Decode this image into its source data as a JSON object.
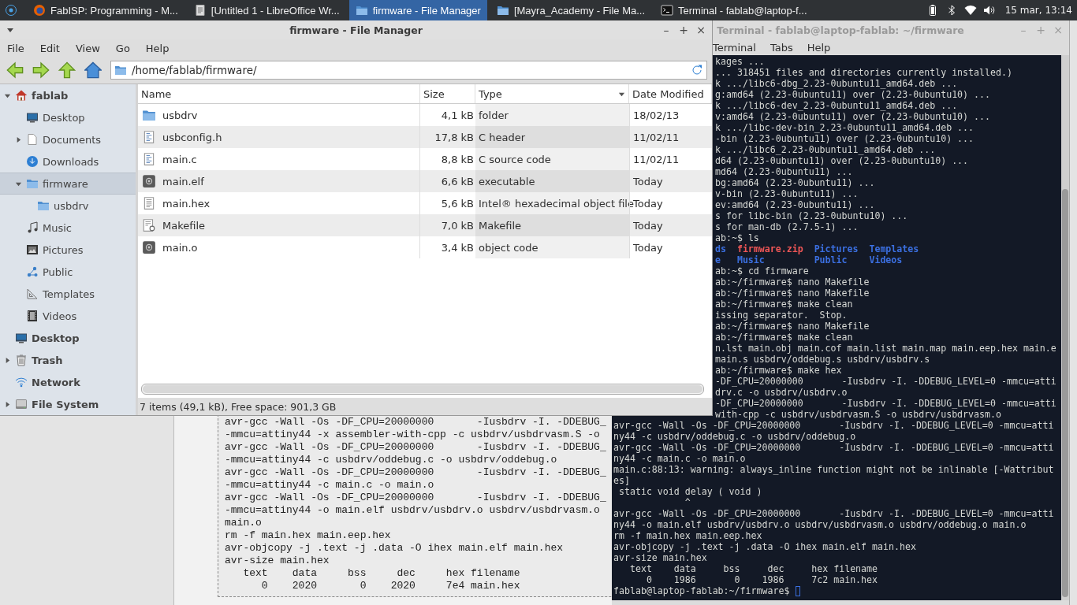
{
  "taskbar": {
    "tasks": [
      {
        "label": "FabISP: Programming - M...",
        "kind": "browser",
        "selected": false
      },
      {
        "label": "[Untitled 1 - LibreOffice Wr...",
        "kind": "writer",
        "selected": false
      },
      {
        "label": "firmware - File Manager",
        "kind": "directory",
        "selected": true
      },
      {
        "label": "[Mayra_Academy - File Ma...",
        "kind": "directory",
        "selected": false
      },
      {
        "label": "Terminal - fablab@laptop-f...",
        "kind": "terminal",
        "selected": false
      }
    ],
    "clock": "15 mar, 13:14"
  },
  "document": {
    "lines": [
      "avr-gcc -Wall -Os -DF_CPU=20000000       -Iusbdrv -I. -DDEBUG_",
      "-mmcu=attiny44 -x assembler-with-cpp -c usbdrv/usbdrvasm.S -o",
      "avr-gcc -Wall -Os -DF_CPU=20000000       -Iusbdrv -I. -DDEBUG_",
      "-mmcu=attiny44 -c usbdrv/oddebug.c -o usbdrv/oddebug.o",
      "avr-gcc -Wall -Os -DF_CPU=20000000       -Iusbdrv -I. -DDEBUG_",
      "-mmcu=attiny44 -c main.c -o main.o",
      "avr-gcc -Wall -Os -DF_CPU=20000000       -Iusbdrv -I. -DDEBUG_",
      "-mmcu=attiny44 -o main.elf usbdrv/usbdrv.o usbdrv/usbdrvasm.o",
      "main.o",
      "rm -f main.hex main.eep.hex",
      "avr-objcopy -j .text -j .data -O ihex main.elf main.hex",
      "avr-size main.hex",
      "   text    data     bss     dec     hex filename",
      "      0    2020       0    2020     7e4 main.hex"
    ]
  },
  "terminal": {
    "title": "Terminal - fablab@laptop-fablab: ~/firmware",
    "window_buttons": [
      "–",
      "+",
      "×"
    ],
    "menu": [
      "Terminal",
      "Tabs",
      "Help"
    ],
    "output_beside": [
      {
        "kind": "text",
        "text": "kages ..."
      },
      {
        "kind": "text",
        "text": "... 318451 files and directories currently installed.)"
      },
      {
        "kind": "text",
        "text": "k .../libc6-dbg_2.23-0ubuntu11_amd64.deb ..."
      },
      {
        "kind": "text",
        "text": "g:amd64 (2.23-0ubuntu11) over (2.23-0ubuntu10) ..."
      },
      {
        "kind": "text",
        "text": "k .../libc6-dev_2.23-0ubuntu11_amd64.deb ..."
      },
      {
        "kind": "text",
        "text": "v:amd64 (2.23-0ubuntu11) over (2.23-0ubuntu10) ..."
      },
      {
        "kind": "text",
        "text": "k .../libc-dev-bin_2.23-0ubuntu11_amd64.deb ..."
      },
      {
        "kind": "text",
        "text": "-bin (2.23-0ubuntu11) over (2.23-0ubuntu10) ..."
      },
      {
        "kind": "text",
        "text": "k .../libc6_2.23-0ubuntu11_amd64.deb ..."
      },
      {
        "kind": "text",
        "text": "d64 (2.23-0ubuntu11) over (2.23-0ubuntu10) ..."
      },
      {
        "kind": "text",
        "text": "md64 (2.23-0ubuntu11) ..."
      },
      {
        "kind": "text",
        "text": "bg:amd64 (2.23-0ubuntu11) ..."
      },
      {
        "kind": "text",
        "text": "v-bin (2.23-0ubuntu11) ..."
      },
      {
        "kind": "text",
        "text": "ev:amd64 (2.23-0ubuntu11) ..."
      },
      {
        "kind": "text",
        "text": "s for libc-bin (2.23-0ubuntu10) ..."
      },
      {
        "kind": "text",
        "text": "s for man-db (2.7.5-1) ..."
      },
      {
        "kind": "text",
        "text": "ab:~$ ls"
      },
      {
        "kind": "listing",
        "entries": [
          {
            "text": "ds",
            "color": "#3b6fe0"
          },
          {
            "text": "firmware.zip",
            "color": "#ef5656"
          },
          {
            "text": "Pictures",
            "color": "#3b6fe0"
          },
          {
            "text": "Templates",
            "color": "#3b6fe0"
          }
        ]
      },
      {
        "kind": "listing",
        "entries": [
          {
            "text": "e",
            "color": "#3b6fe0"
          },
          {
            "text": "Music",
            "color": "#3b6fe0"
          },
          {
            "text": "Public",
            "color": "#3b6fe0"
          },
          {
            "text": "Videos",
            "color": "#3b6fe0"
          }
        ]
      },
      {
        "kind": "text",
        "text": "ab:~$ cd firmware"
      },
      {
        "kind": "text",
        "text": "ab:~/firmware$ nano Makefile"
      },
      {
        "kind": "text",
        "text": "ab:~/firmware$ nano Makefile"
      },
      {
        "kind": "text",
        "text": "ab:~/firmware$ make clean"
      },
      {
        "kind": "text",
        "text": "issing separator.  Stop."
      },
      {
        "kind": "text",
        "text": "ab:~/firmware$ nano Makefile"
      },
      {
        "kind": "text",
        "text": "ab:~/firmware$ make clean"
      },
      {
        "kind": "text",
        "text": "n.lst main.obj main.cof main.list main.map main.eep.hex main.e"
      },
      {
        "kind": "text",
        "text": "main.s usbdrv/oddebug.s usbdrv/usbdrv.s"
      },
      {
        "kind": "text",
        "text": "ab:~/firmware$ make hex"
      },
      {
        "kind": "text",
        "text": "-DF_CPU=20000000       -Iusbdrv -I. -DDEBUG_LEVEL=0 -mmcu=atti"
      },
      {
        "kind": "text",
        "text": "drv.c -o usbdrv/usbdrv.o"
      },
      {
        "kind": "text",
        "text": "-DF_CPU=20000000       -Iusbdrv -I. -DDEBUG_LEVEL=0 -mmcu=atti"
      },
      {
        "kind": "text",
        "text": "with-cpp -c usbdrv/usbdrvasm.S -o usbdrv/usbdrvasm.o"
      }
    ],
    "output_below": [
      {
        "kind": "text",
        "text": "avr-gcc -Wall -Os -DF_CPU=20000000       -Iusbdrv -I. -DDEBUG_LEVEL=0 -mmcu=atti"
      },
      {
        "kind": "text",
        "text": "ny44 -c usbdrv/oddebug.c -o usbdrv/oddebug.o"
      },
      {
        "kind": "text",
        "text": "avr-gcc -Wall -Os -DF_CPU=20000000       -Iusbdrv -I. -DDEBUG_LEVEL=0 -mmcu=atti"
      },
      {
        "kind": "text",
        "text": "ny44 -c main.c -o main.o"
      },
      {
        "kind": "text",
        "text": "main.c:88:13: warning: always_inline function might not be inlinable [-Wattribut"
      },
      {
        "kind": "text",
        "text": "es]"
      },
      {
        "kind": "text",
        "text": " static void delay ( void )"
      },
      {
        "kind": "text",
        "text": "             ^"
      },
      {
        "kind": "text",
        "text": "avr-gcc -Wall -Os -DF_CPU=20000000       -Iusbdrv -I. -DDEBUG_LEVEL=0 -mmcu=atti"
      },
      {
        "kind": "text",
        "text": "ny44 -o main.elf usbdrv/usbdrv.o usbdrv/usbdrvasm.o usbdrv/oddebug.o main.o"
      },
      {
        "kind": "text",
        "text": "rm -f main.hex main.eep.hex"
      },
      {
        "kind": "text",
        "text": "avr-objcopy -j .text -j .data -O ihex main.elf main.hex"
      },
      {
        "kind": "text",
        "text": "avr-size main.hex"
      },
      {
        "kind": "text",
        "text": "   text    data     bss     dec     hex filename"
      },
      {
        "kind": "text",
        "text": "      0    1986       0    1986     7c2 main.hex"
      },
      {
        "kind": "prompt",
        "text": "fablab@laptop-fablab:~/firmware$"
      }
    ]
  },
  "file_manager": {
    "title": "firmware - File Manager",
    "window_buttons": [
      "–",
      "+",
      "×"
    ],
    "menu": [
      "File",
      "Edit",
      "View",
      "Go",
      "Help"
    ],
    "address": "/home/fablab/firmware/",
    "sidebar": {
      "items": [
        {
          "label": "fablab",
          "kind": "home",
          "selected": false,
          "expanded": true,
          "children": [
            {
              "label": "Desktop",
              "kind": "desktop",
              "selected": false
            },
            {
              "label": "Documents",
              "kind": "document",
              "selected": false,
              "expanded": false
            },
            {
              "label": "Downloads",
              "kind": "download",
              "selected": false
            },
            {
              "label": "firmware",
              "kind": "directory",
              "selected": true,
              "expanded": true,
              "children": [
                {
                  "label": "usbdrv",
                  "kind": "directory",
                  "selected": false
                }
              ]
            },
            {
              "label": "Music",
              "kind": "music",
              "selected": false
            },
            {
              "label": "Pictures",
              "kind": "pictures",
              "selected": false
            },
            {
              "label": "Public",
              "kind": "public",
              "selected": false
            },
            {
              "label": "Templates",
              "kind": "templates",
              "selected": false
            },
            {
              "label": "Videos",
              "kind": "videos",
              "selected": false
            }
          ]
        },
        {
          "label": "Desktop",
          "kind": "desktop",
          "selected": false
        },
        {
          "label": "Trash",
          "kind": "trash",
          "selected": false,
          "expanded": false
        },
        {
          "label": "Network",
          "kind": "network",
          "selected": false
        },
        {
          "label": "File System",
          "kind": "drive",
          "selected": false,
          "expanded": false
        }
      ]
    },
    "table": {
      "columns": [
        {
          "label": "Name",
          "sorted": false
        },
        {
          "label": "Size",
          "sorted": false
        },
        {
          "label": "Type",
          "sorted": true
        },
        {
          "label": "Date Modified",
          "sorted": false
        }
      ],
      "rows": [
        {
          "kind": "directory",
          "name": "usbdrv",
          "size": "4,1 kB",
          "type": "folder",
          "date": "18/02/13",
          "selected": false
        },
        {
          "kind": "text",
          "name": "usbconfig.h",
          "size": "17,8 kB",
          "type": "C header",
          "date": "11/02/11",
          "selected": false
        },
        {
          "kind": "text",
          "name": "main.c",
          "size": "8,8 kB",
          "type": "C source code",
          "date": "11/02/11",
          "selected": false
        },
        {
          "kind": "gear",
          "name": "main.elf",
          "size": "6,6 kB",
          "type": "executable",
          "date": "Today",
          "selected": false
        },
        {
          "kind": "plain",
          "name": "main.hex",
          "size": "5,6 kB",
          "type": "Intel® hexadecimal object file",
          "date": "Today",
          "selected": false
        },
        {
          "kind": "makefile",
          "name": "Makefile",
          "size": "7,0 kB",
          "type": "Makefile",
          "date": "Today",
          "selected": false
        },
        {
          "kind": "gear",
          "name": "main.o",
          "size": "3,4 kB",
          "type": "object code",
          "date": "Today",
          "selected": false
        }
      ]
    },
    "status_bar": "7 items (49,1 kB), Free space: 901,3 GB"
  }
}
